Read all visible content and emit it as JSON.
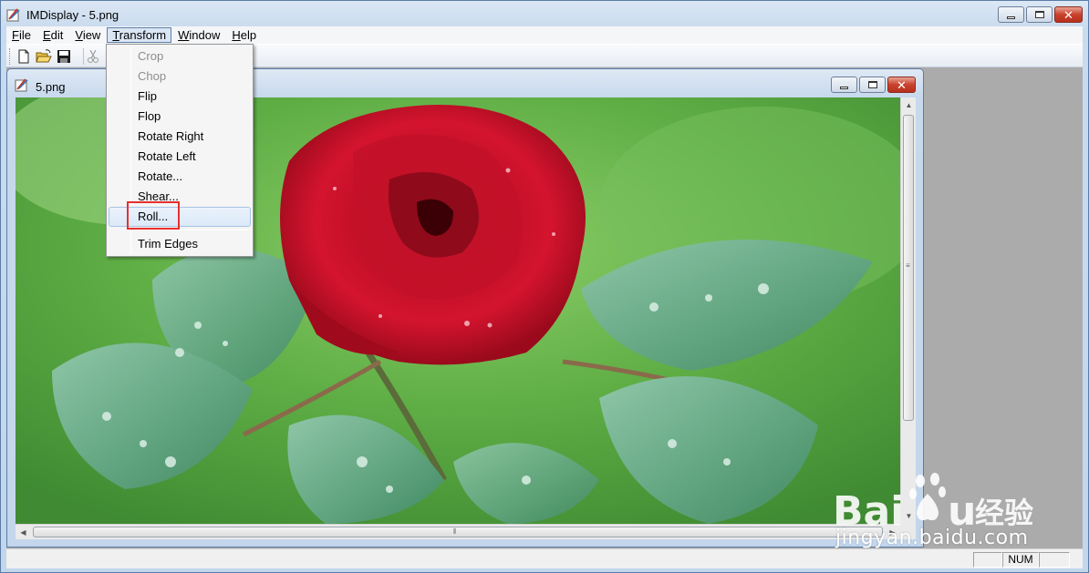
{
  "app": {
    "title": "IMDisplay - 5.png",
    "window_controls": [
      "minimize",
      "maximize",
      "close"
    ]
  },
  "menubar": {
    "items": [
      {
        "label": "File",
        "mnemonic": "F",
        "rest": "ile"
      },
      {
        "label": "Edit",
        "mnemonic": "E",
        "rest": "dit"
      },
      {
        "label": "View",
        "mnemonic": "V",
        "rest": "iew"
      },
      {
        "label": "Transform",
        "mnemonic": "T",
        "rest": "ransform",
        "active": true
      },
      {
        "label": "Window",
        "mnemonic": "W",
        "rest": "indow"
      },
      {
        "label": "Help",
        "mnemonic": "H",
        "rest": "elp"
      }
    ]
  },
  "toolbar": {
    "buttons": [
      "new-file-icon",
      "open-folder-icon",
      "save-disk-icon",
      "cut-scissors-icon"
    ]
  },
  "transform_menu": {
    "items": [
      {
        "label": "Crop",
        "enabled": false
      },
      {
        "label": "Chop",
        "enabled": false
      },
      {
        "label": "Flip",
        "enabled": true
      },
      {
        "label": "Flop",
        "enabled": true
      },
      {
        "label": "Rotate Right",
        "enabled": true
      },
      {
        "label": "Rotate Left",
        "enabled": true
      },
      {
        "label": "Rotate...",
        "enabled": true
      },
      {
        "label": "Shear...",
        "enabled": true
      },
      {
        "label": "Roll...",
        "enabled": true,
        "highlighted": true
      },
      {
        "label": "Trim Edges",
        "enabled": true
      }
    ]
  },
  "child_window": {
    "title": "5.png",
    "image_subject": "red rose with water droplets on green leaves"
  },
  "statusbar": {
    "panes": [
      "",
      "NUM",
      ""
    ]
  },
  "watermark": {
    "brand": "Bai",
    "brand_end": "u",
    "brand_cn": "经验",
    "url": "jingyan.baidu.com"
  },
  "colors": {
    "highlight_box": "#e6302d",
    "mdi_background": "#ababab",
    "rose": "#c8102e"
  }
}
